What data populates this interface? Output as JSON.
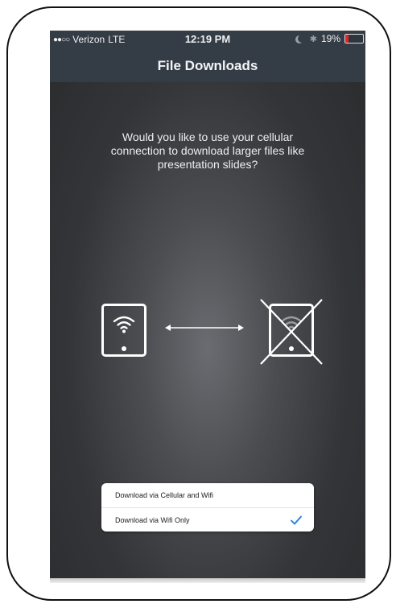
{
  "status_bar": {
    "signal": "●●○○",
    "carrier": "Verizon",
    "network": "LTE",
    "time": "12:19 PM",
    "battery": "19%",
    "battery_level": 0.19,
    "battery_color": "#e0252b"
  },
  "header": {
    "title": "File Downloads"
  },
  "prompt": {
    "text": "Would you like to use your cellular connection to download larger files like presentation slides?"
  },
  "illustration": {
    "left_icon": "tablet-wifi-icon",
    "middle_icon": "double-arrow-icon",
    "right_icon": "tablet-wifi-crossed-icon"
  },
  "options": {
    "items": [
      {
        "label": "Download via Cellular and Wifi",
        "selected": false
      },
      {
        "label": "Download via Wifi Only",
        "selected": true
      }
    ],
    "check_color": "#1e7be0"
  }
}
